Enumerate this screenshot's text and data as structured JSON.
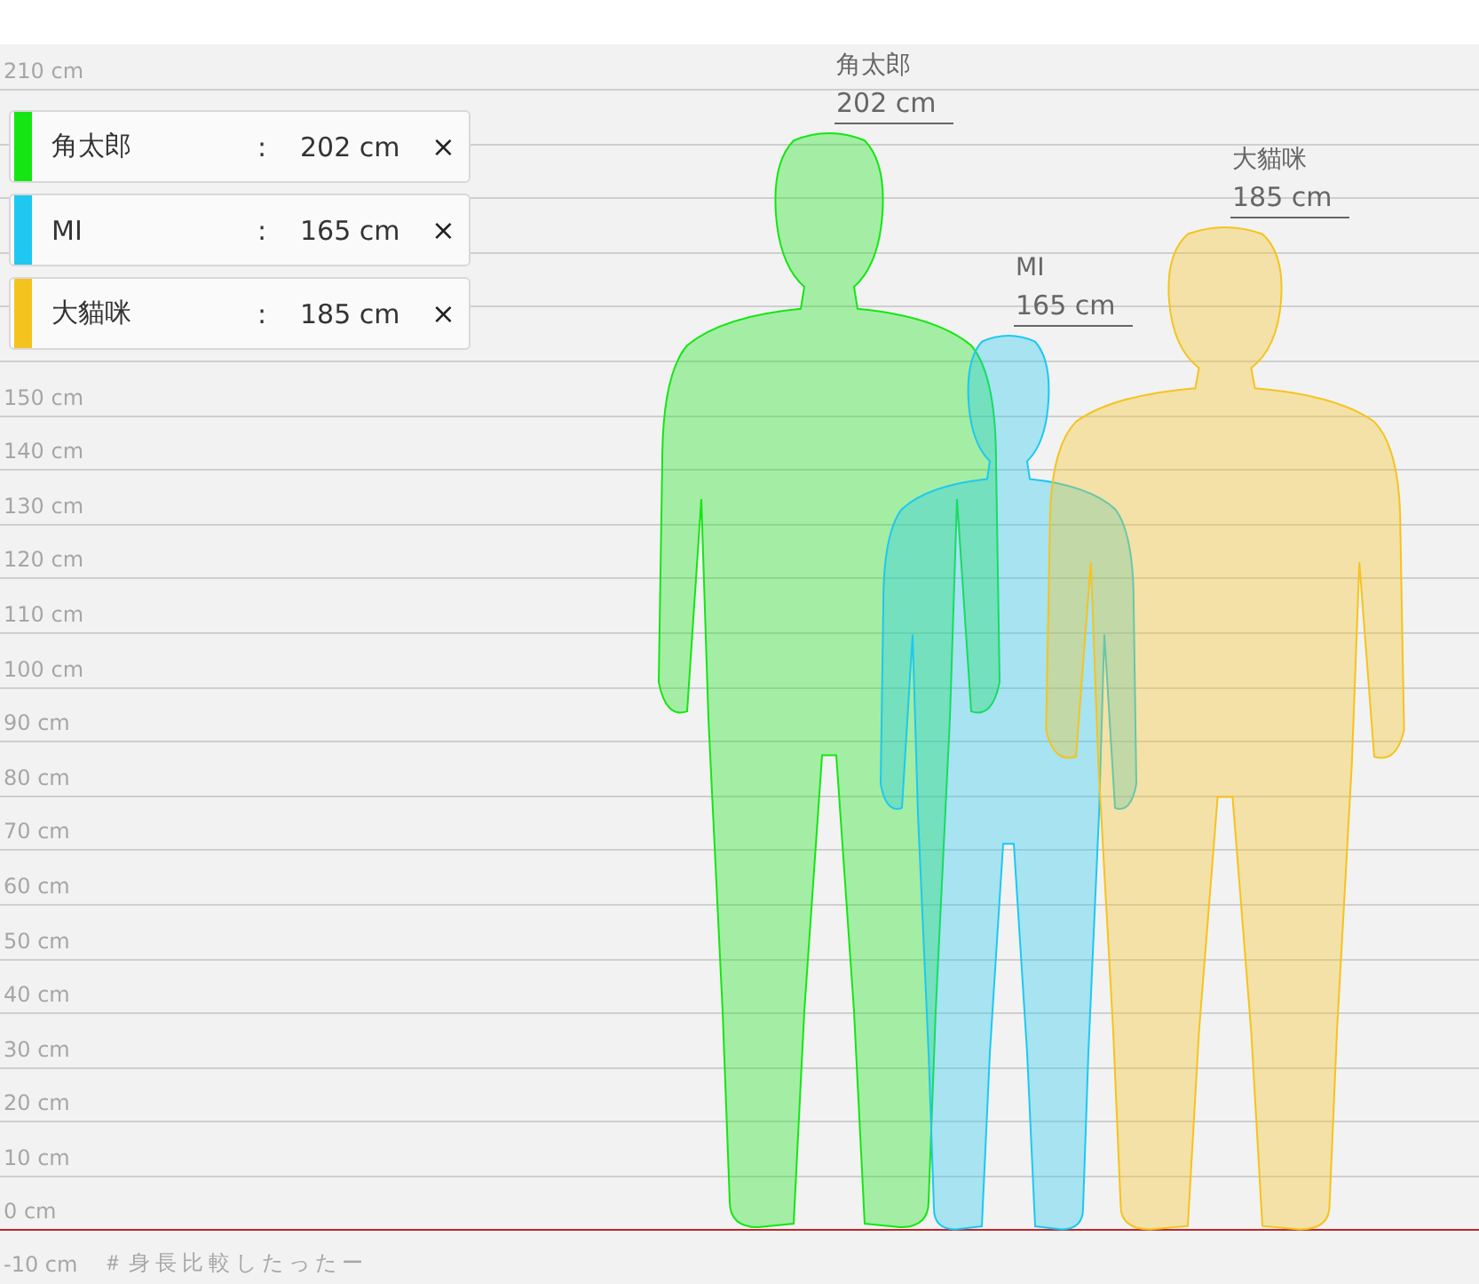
{
  "axis": {
    "ticks": [
      "210 cm",
      "150 cm",
      "140 cm",
      "130 cm",
      "120 cm",
      "110 cm",
      "100 cm",
      "90 cm",
      "80 cm",
      "70 cm",
      "60 cm",
      "50 cm",
      "40 cm",
      "30 cm",
      "20 cm",
      "10 cm",
      "0 cm"
    ],
    "below": "-10 cm"
  },
  "footer_tag": "＃身長比較したったー",
  "legend": [
    {
      "name": "角太郎",
      "separator": ":",
      "height": "202 cm",
      "remove": "×",
      "color": "#14e614"
    },
    {
      "name": "MI",
      "separator": ":",
      "height": "165 cm",
      "remove": "×",
      "color": "#1ec8f0"
    },
    {
      "name": "大貓咪",
      "separator": ":",
      "height": "185 cm",
      "remove": "×",
      "color": "#f5c31e"
    }
  ],
  "figures": [
    {
      "name": "角太郎",
      "height": "202 cm",
      "color": "#14e614"
    },
    {
      "name": "MI",
      "height": "165 cm",
      "color": "#1ec8f0"
    },
    {
      "name": "大貓咪",
      "height": "185 cm",
      "color": "#f5c31e"
    }
  ]
}
